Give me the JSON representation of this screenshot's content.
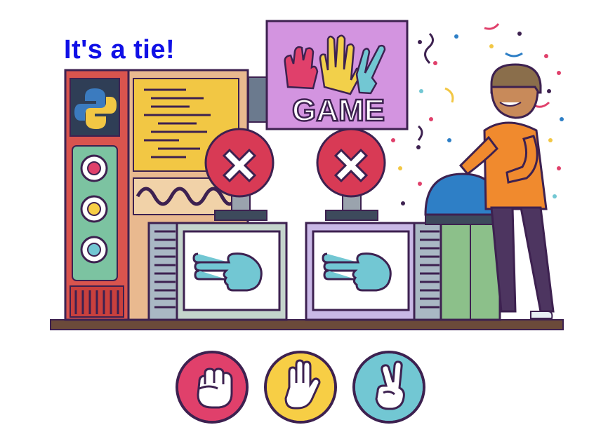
{
  "game": {
    "result_text": "It's a tie!",
    "result_color": "#1010e6",
    "marquee_label": "GAME",
    "computer_choice_icon": "scissors-hand-icon",
    "player_choice_icon": "scissors-hand-icon",
    "computer_status_icon": "x-mark-icon",
    "player_status_icon": "x-mark-icon"
  },
  "choices": [
    {
      "name": "rock",
      "icon": "fist-icon",
      "color": "#e0406b"
    },
    {
      "name": "paper",
      "icon": "open-hand-icon",
      "color": "#f7ce45"
    },
    {
      "name": "scissors",
      "icon": "peace-hand-icon",
      "color": "#72c7d3"
    }
  ],
  "colors": {
    "outline": "#3d2150",
    "red_ball": "#d83a55",
    "blue_dome": "#2e7fc6",
    "floor": "#6b4a3a"
  }
}
